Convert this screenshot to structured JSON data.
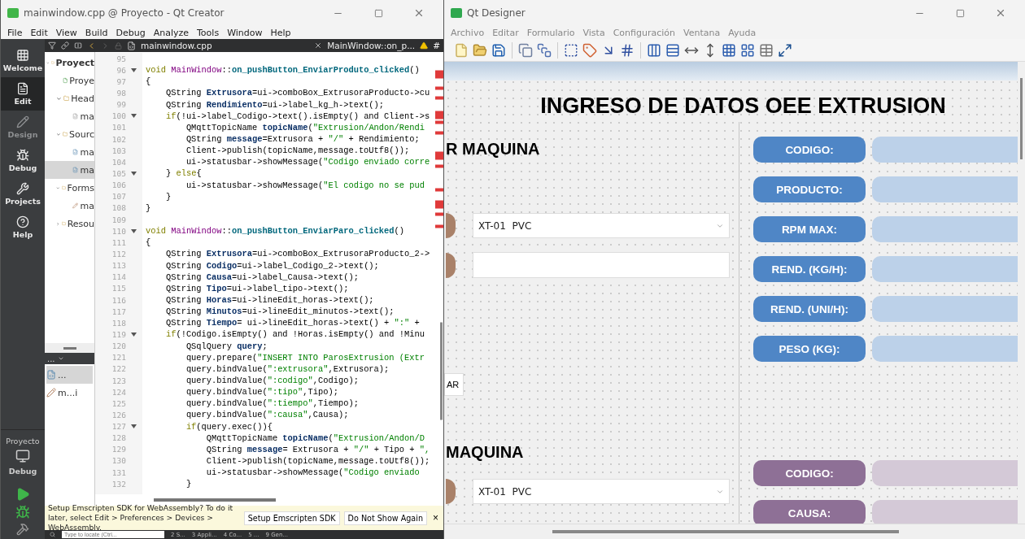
{
  "creator": {
    "title": "mainwindow.cpp @ Proyecto - Qt Creator",
    "menu": [
      "File",
      "Edit",
      "View",
      "Build",
      "Debug",
      "Analyze",
      "Tools",
      "Window",
      "Help"
    ],
    "modes": [
      {
        "kind": "welcome",
        "label": "Welcome",
        "selected": false,
        "disabled": false
      },
      {
        "kind": "edit",
        "label": "Edit",
        "selected": true,
        "disabled": false
      },
      {
        "kind": "design",
        "label": "Design",
        "selected": false,
        "disabled": true
      },
      {
        "kind": "debug",
        "label": "Debug",
        "selected": false,
        "disabled": false
      },
      {
        "kind": "projects",
        "label": "Projects",
        "selected": false,
        "disabled": false
      },
      {
        "kind": "help",
        "label": "Help",
        "selected": false,
        "disabled": false
      }
    ],
    "kit": {
      "project": "Proyecto",
      "build": "Debug"
    },
    "editor_toolbar": {
      "file": "mainwindow.cpp",
      "symbol": "MainWindow::on_p...",
      "hash": "#"
    },
    "tree": [
      {
        "kind": "project",
        "label": "Proyect",
        "expanded": true,
        "selected": false,
        "children": [
          {
            "kind": "profile",
            "label": "Proye",
            "selected": false
          },
          {
            "kind": "folder",
            "label": "Head",
            "expanded": true,
            "selected": false,
            "children": [
              {
                "kind": "header",
                "label": "ma",
                "selected": false
              }
            ]
          },
          {
            "kind": "folder",
            "label": "Sourc",
            "expanded": true,
            "selected": false,
            "children": [
              {
                "kind": "source",
                "label": "ma",
                "selected": false
              },
              {
                "kind": "source",
                "label": "ma",
                "selected": true
              }
            ]
          },
          {
            "kind": "folder",
            "label": "Forms",
            "expanded": true,
            "selected": false,
            "children": [
              {
                "kind": "form",
                "label": "ma",
                "selected": false
              }
            ]
          },
          {
            "kind": "folder",
            "label": "Resou",
            "expanded": false,
            "selected": false
          }
        ]
      }
    ],
    "open_docs": {
      "header": "...",
      "items": [
        {
          "kind": "source",
          "label": "...",
          "selected": true
        },
        {
          "kind": "form",
          "label": "m...i",
          "selected": false
        }
      ]
    },
    "code": [
      {
        "n": "95",
        "fold": false
      },
      {
        "n": "96",
        "fold": true,
        "segs": [
          {
            "kind": "kw",
            "t": "void "
          },
          {
            "kind": "cls",
            "t": "MainWindow"
          },
          {
            "kind": "p",
            "t": "::"
          },
          {
            "kind": "fn",
            "t": "on_pushButton_EnviarProduto_clicked"
          },
          {
            "kind": "p",
            "t": "()"
          }
        ]
      },
      {
        "n": "97",
        "fold": false,
        "segs": [
          {
            "kind": "p",
            "t": "{"
          }
        ]
      },
      {
        "n": "98",
        "fold": false,
        "segs": [
          {
            "kind": "p",
            "t": "    QString "
          },
          {
            "kind": "var",
            "t": "Extrusora"
          },
          {
            "kind": "p",
            "t": "=ui->comboBox_ExtrusoraProducto->cu"
          }
        ]
      },
      {
        "n": "99",
        "fold": false,
        "segs": [
          {
            "kind": "p",
            "t": "    QString "
          },
          {
            "kind": "var",
            "t": "Rendimiento"
          },
          {
            "kind": "p",
            "t": "=ui->label_kg_h->text();"
          }
        ]
      },
      {
        "n": "100",
        "fold": true,
        "segs": [
          {
            "kind": "kw",
            "t": "    if"
          },
          {
            "kind": "p",
            "t": "(!ui->label_Codigo->text().isEmpty() and Client->s"
          }
        ]
      },
      {
        "n": "101",
        "fold": false,
        "segs": [
          {
            "kind": "p",
            "t": "        QMqttTopicName "
          },
          {
            "kind": "var",
            "t": "topicName"
          },
          {
            "kind": "p",
            "t": "("
          },
          {
            "kind": "str",
            "t": "\"Extrusion/Andon/Rendi"
          }
        ]
      },
      {
        "n": "102",
        "fold": false,
        "segs": [
          {
            "kind": "p",
            "t": "        QString "
          },
          {
            "kind": "var",
            "t": "message"
          },
          {
            "kind": "p",
            "t": "=Extrusora + "
          },
          {
            "kind": "str",
            "t": "\"/\""
          },
          {
            "kind": "p",
            "t": " + Rendimiento;"
          }
        ]
      },
      {
        "n": "103",
        "fold": false,
        "segs": [
          {
            "kind": "p",
            "t": "        Client->publish(topicName,message.toUtf8());"
          }
        ]
      },
      {
        "n": "104",
        "fold": false,
        "segs": [
          {
            "kind": "p",
            "t": "        ui->statusbar->showMessage("
          },
          {
            "kind": "str",
            "t": "\"Codigo enviado corre"
          }
        ]
      },
      {
        "n": "105",
        "fold": true,
        "segs": [
          {
            "kind": "p",
            "t": "    } "
          },
          {
            "kind": "kw",
            "t": "else"
          },
          {
            "kind": "p",
            "t": "{"
          }
        ]
      },
      {
        "n": "106",
        "fold": false,
        "segs": [
          {
            "kind": "p",
            "t": "        ui->statusbar->showMessage("
          },
          {
            "kind": "str",
            "t": "\"El codigo no se pud"
          }
        ]
      },
      {
        "n": "107",
        "fold": false,
        "segs": [
          {
            "kind": "p",
            "t": "    }"
          }
        ]
      },
      {
        "n": "108",
        "fold": false,
        "segs": [
          {
            "kind": "p",
            "t": "}"
          }
        ]
      },
      {
        "n": "109",
        "fold": false
      },
      {
        "n": "110",
        "fold": true,
        "segs": [
          {
            "kind": "kw",
            "t": "void "
          },
          {
            "kind": "cls",
            "t": "MainWindow"
          },
          {
            "kind": "p",
            "t": "::"
          },
          {
            "kind": "fn",
            "t": "on_pushButton_EnviarParo_clicked"
          },
          {
            "kind": "p",
            "t": "()"
          }
        ]
      },
      {
        "n": "111",
        "fold": false,
        "segs": [
          {
            "kind": "p",
            "t": "{"
          }
        ]
      },
      {
        "n": "112",
        "fold": false,
        "segs": [
          {
            "kind": "p",
            "t": "    QString "
          },
          {
            "kind": "var",
            "t": "Extrusora"
          },
          {
            "kind": "p",
            "t": "=ui->comboBox_ExtrusoraProducto_2->"
          }
        ]
      },
      {
        "n": "113",
        "fold": false,
        "segs": [
          {
            "kind": "p",
            "t": "    QString "
          },
          {
            "kind": "var",
            "t": "Codigo"
          },
          {
            "kind": "p",
            "t": "=ui->label_Codigo_2->text();"
          }
        ]
      },
      {
        "n": "114",
        "fold": false,
        "segs": [
          {
            "kind": "p",
            "t": "    QString "
          },
          {
            "kind": "var",
            "t": "Causa"
          },
          {
            "kind": "p",
            "t": "=ui->label_Causa->text();"
          }
        ]
      },
      {
        "n": "115",
        "fold": false,
        "segs": [
          {
            "kind": "p",
            "t": "    QString "
          },
          {
            "kind": "var",
            "t": "Tipo"
          },
          {
            "kind": "p",
            "t": "=ui->label_tipo->text();"
          }
        ]
      },
      {
        "n": "116",
        "fold": false,
        "segs": [
          {
            "kind": "p",
            "t": "    QString "
          },
          {
            "kind": "var",
            "t": "Horas"
          },
          {
            "kind": "p",
            "t": "=ui->lineEdit_horas->text();"
          }
        ]
      },
      {
        "n": "117",
        "fold": false,
        "segs": [
          {
            "kind": "p",
            "t": "    QString "
          },
          {
            "kind": "var",
            "t": "Minutos"
          },
          {
            "kind": "p",
            "t": "=ui->lineEdit_minutos->text();"
          }
        ]
      },
      {
        "n": "118",
        "fold": false,
        "segs": [
          {
            "kind": "p",
            "t": "    QString "
          },
          {
            "kind": "var",
            "t": "Tiempo"
          },
          {
            "kind": "p",
            "t": "= ui->lineEdit_horas->text() + "
          },
          {
            "kind": "str",
            "t": "\":\""
          },
          {
            "kind": "p",
            "t": " +"
          }
        ]
      },
      {
        "n": "119",
        "fold": true,
        "segs": [
          {
            "kind": "kw",
            "t": "    if"
          },
          {
            "kind": "p",
            "t": "(!Codigo.isEmpty() and !Horas.isEmpty() and !Minu"
          }
        ]
      },
      {
        "n": "120",
        "fold": false,
        "segs": [
          {
            "kind": "p",
            "t": "        QSqlQuery "
          },
          {
            "kind": "var",
            "t": "query"
          },
          {
            "kind": "p",
            "t": ";"
          }
        ]
      },
      {
        "n": "121",
        "fold": false,
        "segs": [
          {
            "kind": "p",
            "t": "        query.prepare("
          },
          {
            "kind": "str",
            "t": "\"INSERT INTO ParosExtrusion (Extr"
          }
        ]
      },
      {
        "n": "122",
        "fold": false,
        "segs": [
          {
            "kind": "p",
            "t": "        query.bindValue("
          },
          {
            "kind": "str",
            "t": "\":extrusora\""
          },
          {
            "kind": "p",
            "t": ",Extrusora);"
          }
        ]
      },
      {
        "n": "123",
        "fold": false,
        "segs": [
          {
            "kind": "p",
            "t": "        query.bindValue("
          },
          {
            "kind": "str",
            "t": "\":codigo\""
          },
          {
            "kind": "p",
            "t": ",Codigo);"
          }
        ]
      },
      {
        "n": "124",
        "fold": false,
        "segs": [
          {
            "kind": "p",
            "t": "        query.bindValue("
          },
          {
            "kind": "str",
            "t": "\":tipo\""
          },
          {
            "kind": "p",
            "t": ",Tipo);"
          }
        ]
      },
      {
        "n": "125",
        "fold": false,
        "segs": [
          {
            "kind": "p",
            "t": "        query.bindValue("
          },
          {
            "kind": "str",
            "t": "\":tiempo\""
          },
          {
            "kind": "p",
            "t": ",Tiempo);"
          }
        ]
      },
      {
        "n": "126",
        "fold": false,
        "segs": [
          {
            "kind": "p",
            "t": "        query.bindValue("
          },
          {
            "kind": "str",
            "t": "\":causa\""
          },
          {
            "kind": "p",
            "t": ",Causa);"
          }
        ]
      },
      {
        "n": "127",
        "fold": true,
        "segs": [
          {
            "kind": "kw",
            "t": "        if"
          },
          {
            "kind": "p",
            "t": "(query.exec()){"
          }
        ]
      },
      {
        "n": "128",
        "fold": false,
        "segs": [
          {
            "kind": "p",
            "t": "            QMqttTopicName "
          },
          {
            "kind": "var",
            "t": "topicName"
          },
          {
            "kind": "p",
            "t": "("
          },
          {
            "kind": "str",
            "t": "\"Extrusion/Andon/D"
          }
        ]
      },
      {
        "n": "129",
        "fold": false,
        "segs": [
          {
            "kind": "p",
            "t": "            QString "
          },
          {
            "kind": "var",
            "t": "message"
          },
          {
            "kind": "p",
            "t": "= Extrusora + "
          },
          {
            "kind": "str",
            "t": "\"/\""
          },
          {
            "kind": "p",
            "t": " + Tipo + "
          },
          {
            "kind": "str",
            "t": "\","
          }
        ]
      },
      {
        "n": "130",
        "fold": false,
        "segs": [
          {
            "kind": "p",
            "t": "            Client->publish(topicName,message.toUtf8());"
          }
        ]
      },
      {
        "n": "131",
        "fold": false,
        "segs": [
          {
            "kind": "p",
            "t": "            ui->statusbar->showMessage("
          },
          {
            "kind": "str",
            "t": "\"Codigo enviado"
          }
        ]
      },
      {
        "n": "132",
        "fold": false,
        "segs": [
          {
            "kind": "p",
            "t": "        }"
          }
        ]
      }
    ],
    "notification": {
      "text": "Setup Emscripten SDK for WebAssembly? To do it later, select Edit > Preferences > Devices > WebAssembly.",
      "buttons": [
        "Setup Emscripten SDK",
        "Do Not Show Again"
      ],
      "close": "×"
    },
    "status": {
      "placeholder": "Type to locate (Ctrl...",
      "panes": [
        "2 S...",
        "3 Appli...",
        "4 Co...",
        "5 ...",
        "9 Gen..."
      ]
    }
  },
  "designer": {
    "title": "Qt Designer",
    "menu": [
      "Archivo",
      "Editar",
      "Formulario",
      "Vista",
      "Configuración",
      "Ventana",
      "Ayuda"
    ],
    "form": {
      "title": "INGRESO DE DATOS OEE EXTRUSION",
      "sections": [
        {
          "heading": "R MAQUINA",
          "fields": [
            {
              "kind": "combo",
              "value": "XT-01  PVC"
            },
            {
              "kind": "input"
            }
          ],
          "button": "AR"
        },
        {
          "heading": "MAQUINA",
          "fields": [
            {
              "kind": "combo",
              "value": "XT-01  PVC"
            }
          ]
        }
      ],
      "groups": [
        {
          "color": "#4f86c6",
          "labels": [
            "CODIGO:",
            "PRODUCTO:",
            "RPM MAX:",
            "REND. (KG/H):",
            "REND. (UNI/H):",
            "PESO (KG):"
          ]
        },
        {
          "color": "#8e7096",
          "labels": [
            "CODIGO:",
            "CAUSA:"
          ]
        }
      ]
    }
  }
}
